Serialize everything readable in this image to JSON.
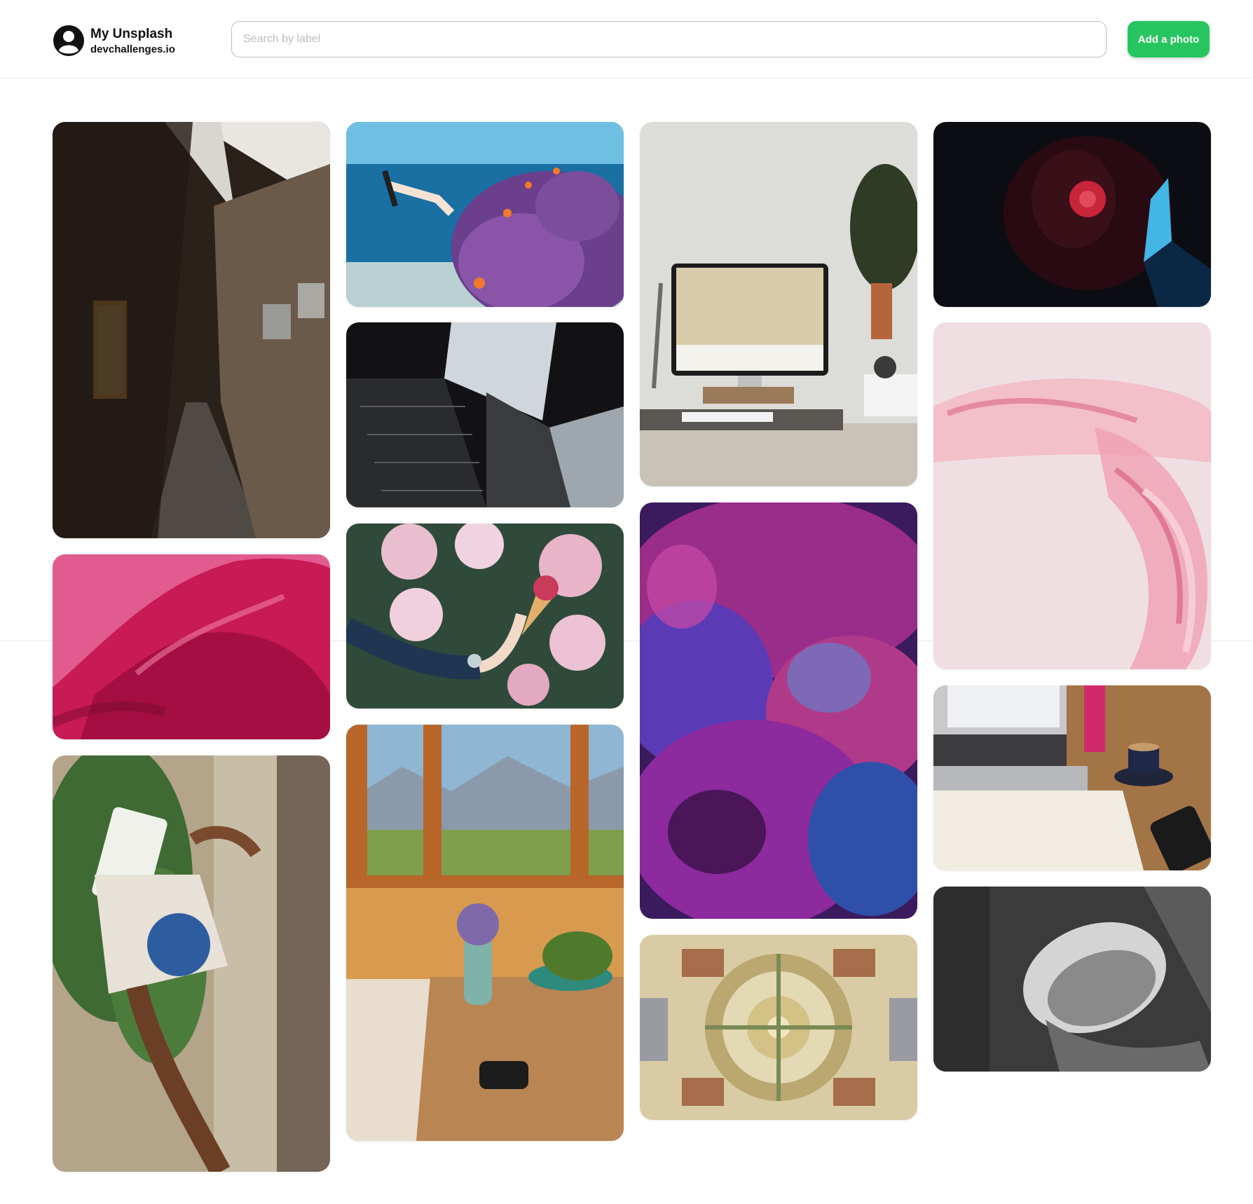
{
  "header": {
    "app_name": "My Unsplash",
    "app_domain": "devchallenges.io",
    "logo_icon": "user-circle-icon",
    "search": {
      "placeholder": "Search by label",
      "value": ""
    },
    "add_button_label": "Add a photo",
    "add_button_color": "#27c560"
  },
  "gallery": {
    "photos": [
      {
        "label": "",
        "subject": "japanese alley at dusk"
      },
      {
        "label": "",
        "subject": "pink silk fabric"
      },
      {
        "label": "",
        "subject": "hands holding gratitude cards"
      },
      {
        "label": "",
        "subject": "diver over coral reef"
      },
      {
        "label": "",
        "subject": "looking up between buildings"
      },
      {
        "label": "",
        "subject": "ice cream among rhododendrons"
      },
      {
        "label": "",
        "subject": "window view of mountains over table"
      },
      {
        "label": "",
        "subject": "desk with monitor and plant"
      },
      {
        "label": "",
        "subject": "purple coral macro"
      },
      {
        "label": "",
        "subject": "baroque ceiling dome"
      },
      {
        "label": "",
        "subject": "man with headphones in dark"
      },
      {
        "label": "",
        "subject": "pink glass sculpture"
      },
      {
        "label": "",
        "subject": "laptop, coffee and notebook"
      },
      {
        "label": "",
        "subject": "concrete circular window"
      }
    ]
  }
}
